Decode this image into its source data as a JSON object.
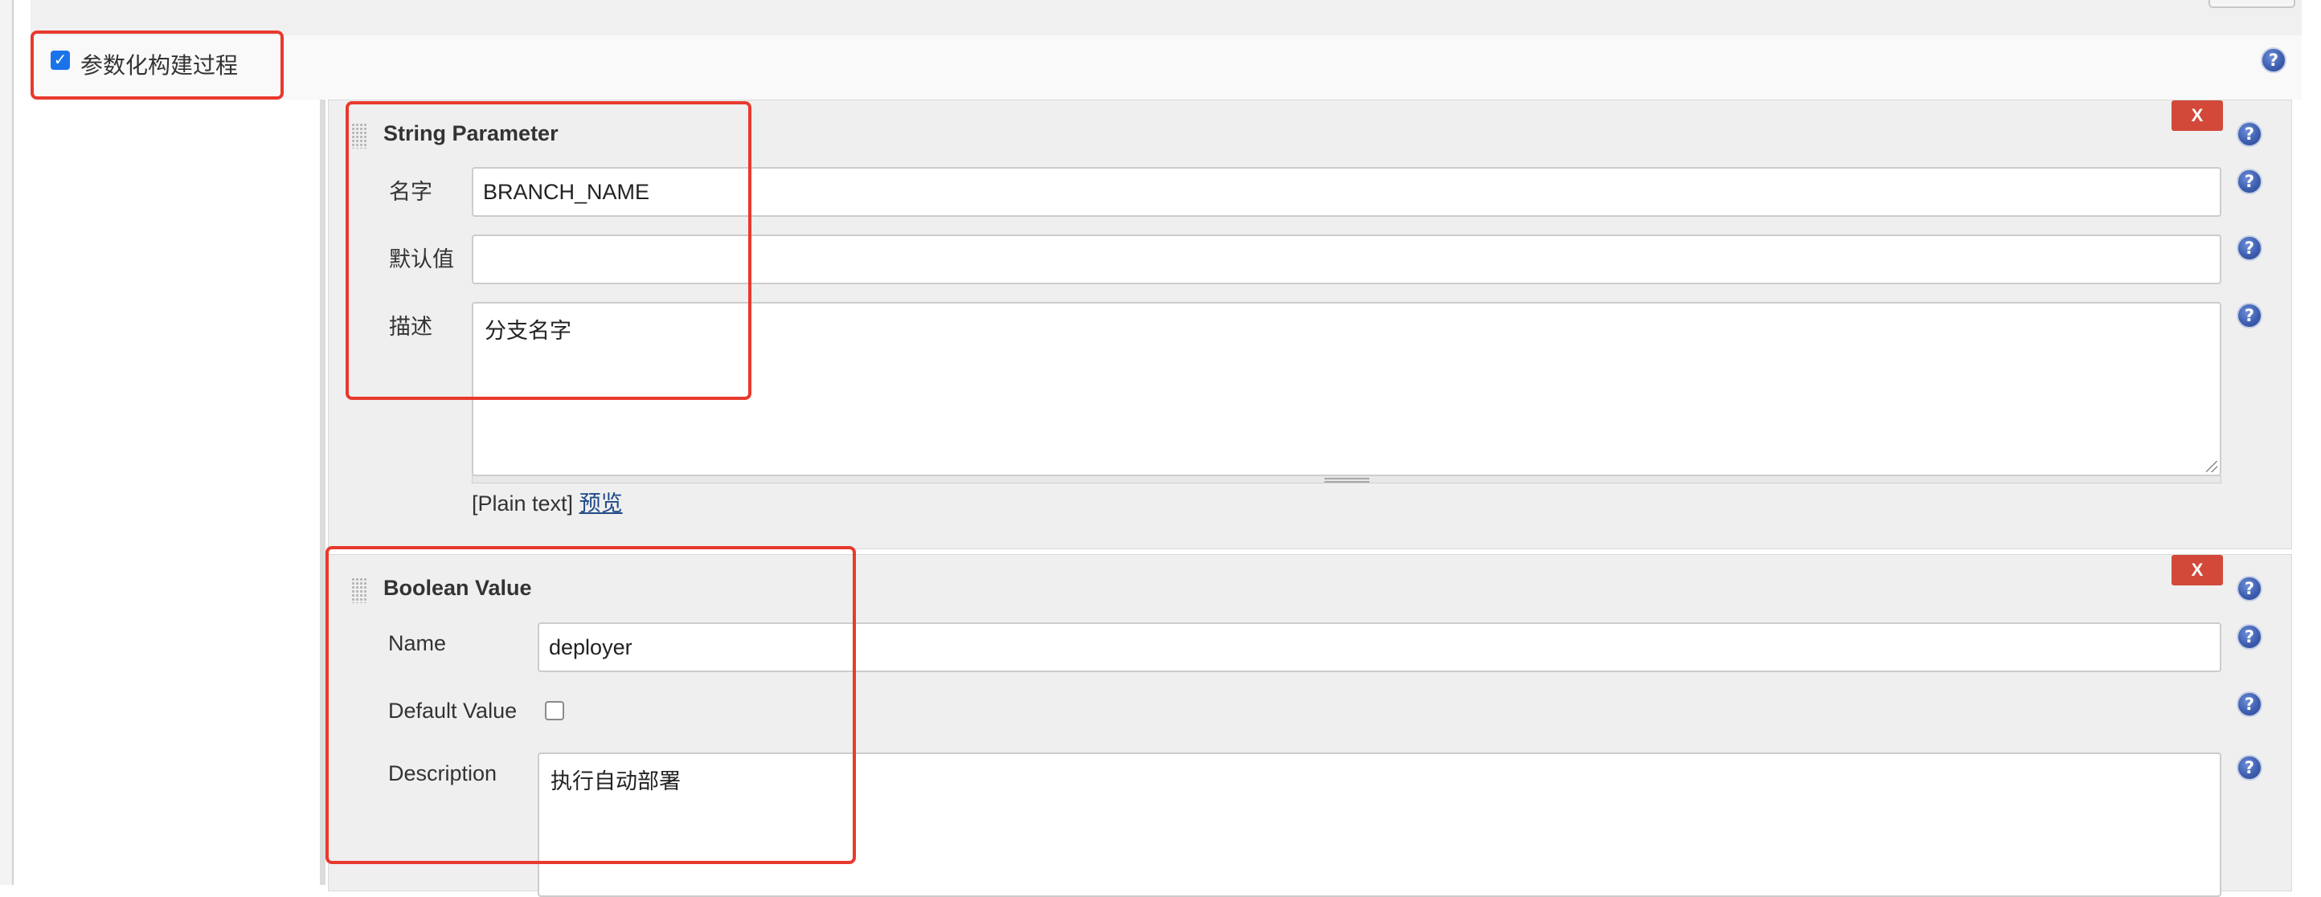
{
  "enable_section": {
    "checked": true,
    "label": "参数化构建过程"
  },
  "string_parameter": {
    "title": "String Parameter",
    "delete_label": "X",
    "name_label": "名字",
    "name_value": "BRANCH_NAME",
    "default_label": "默认值",
    "default_value": "",
    "description_label": "描述",
    "description_value": "分支名字",
    "format_note": "[Plain text]",
    "preview_link": "预览"
  },
  "boolean_parameter": {
    "title": "Boolean Value",
    "delete_label": "X",
    "name_label": "Name",
    "name_value": "deployer",
    "default_label": "Default Value",
    "default_checked": false,
    "description_label": "Description",
    "description_value": "执行自动部署"
  },
  "help_icon": "?",
  "colors": {
    "accent_blue": "#1a73e8",
    "delete_red": "#d24939",
    "annotation_red": "#e8392d",
    "link": "#204a87"
  }
}
